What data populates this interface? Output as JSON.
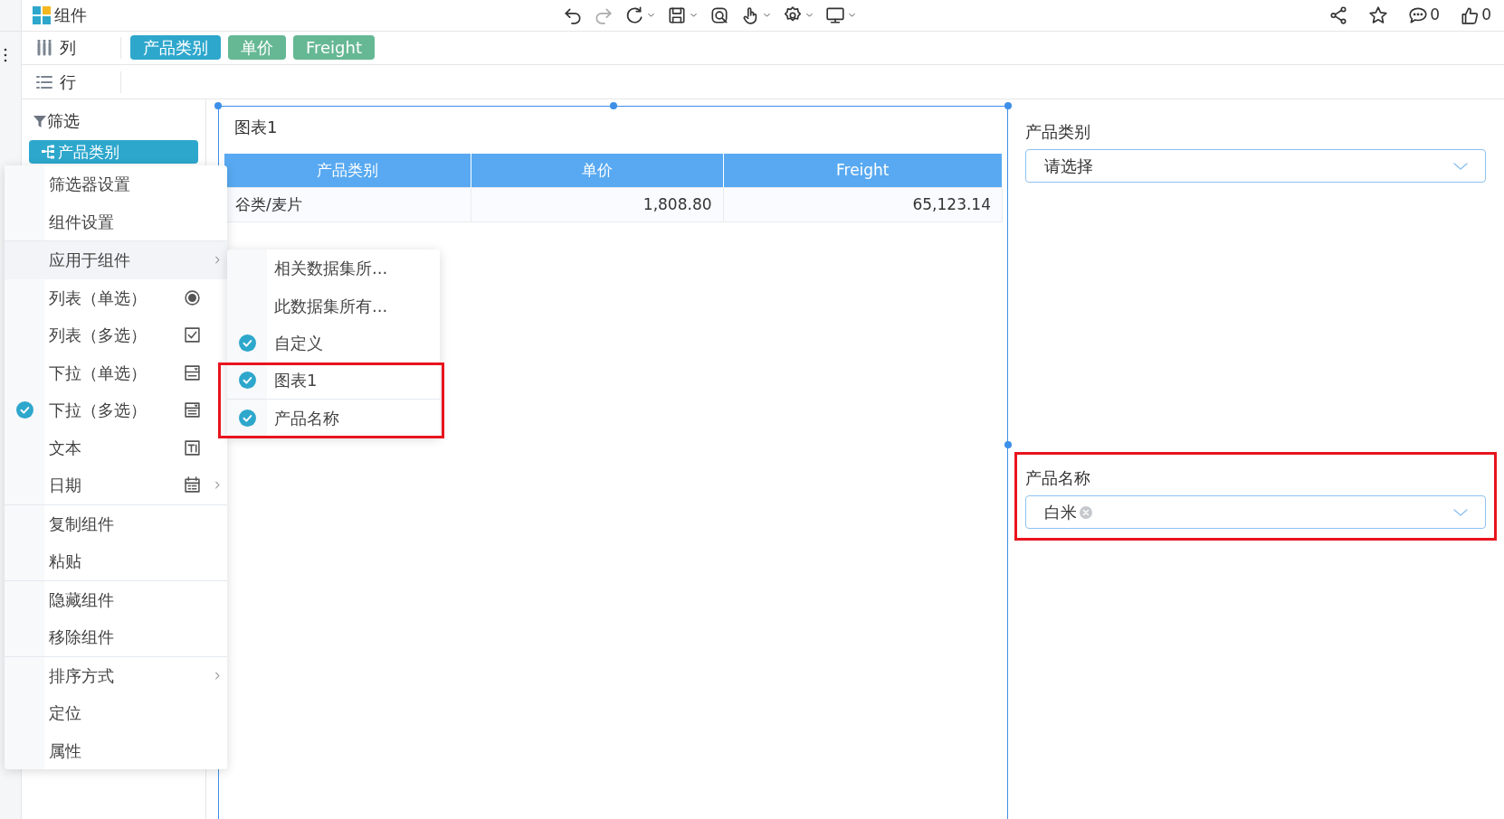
{
  "header": {
    "title": "组件"
  },
  "toolbar": [
    {
      "kind": "undo",
      "disabled": false,
      "dropdown": false
    },
    {
      "kind": "redo",
      "disabled": true,
      "dropdown": false
    },
    {
      "kind": "refresh",
      "disabled": false,
      "dropdown": true
    },
    {
      "kind": "save",
      "disabled": false,
      "dropdown": true
    },
    {
      "kind": "preview",
      "disabled": false,
      "dropdown": false
    },
    {
      "kind": "hand",
      "disabled": false,
      "dropdown": true
    },
    {
      "kind": "settings",
      "disabled": false,
      "dropdown": true
    },
    {
      "kind": "monitor",
      "disabled": false,
      "dropdown": true
    }
  ],
  "actions": [
    {
      "kind": "share"
    },
    {
      "kind": "favorite"
    },
    {
      "kind": "comment",
      "count": "0"
    },
    {
      "kind": "like",
      "count": "0"
    }
  ],
  "columns_shelf": {
    "label": "列",
    "fields": [
      {
        "label": "产品类别",
        "color": "#2ea7cc"
      },
      {
        "label": "单价",
        "color": "#66b894"
      },
      {
        "label": "Freight",
        "color": "#66b894"
      }
    ]
  },
  "rows_shelf": {
    "label": "行"
  },
  "filter_panel": {
    "title": "筛选",
    "items": [
      {
        "label": "产品类别",
        "selected": true
      }
    ]
  },
  "chart": {
    "title": "图表1",
    "columns": [
      "产品类别",
      "单价",
      "Freight"
    ],
    "rows": [
      [
        "谷类/麦片",
        "1,808.80",
        "65,123.14"
      ]
    ]
  },
  "filters": [
    {
      "label": "产品类别",
      "placeholder": "请选择",
      "highlighted": false
    },
    {
      "label": "产品名称",
      "tags": [
        "白米"
      ],
      "highlighted": true
    }
  ],
  "context_menu": {
    "sections": [
      {
        "items": [
          {
            "label": "筛选器设置",
            "kind": "action",
            "checked": false,
            "submenu": false,
            "selected": false
          },
          {
            "label": "组件设置",
            "kind": "action",
            "checked": false,
            "submenu": false,
            "selected": false
          }
        ]
      },
      {
        "items": [
          {
            "label": "应用于组件",
            "kind": "action",
            "checked": false,
            "submenu": true,
            "selected": true
          },
          {
            "label": "列表（单选）",
            "kind": "list-single",
            "checked": false,
            "submenu": false,
            "selected": false
          },
          {
            "label": "列表（多选）",
            "kind": "list-multi",
            "checked": false,
            "submenu": false,
            "selected": false
          },
          {
            "label": "下拉（单选）",
            "kind": "dropdown-single",
            "checked": false,
            "submenu": false,
            "selected": false
          },
          {
            "label": "下拉（多选）",
            "kind": "dropdown-multi",
            "checked": true,
            "submenu": false,
            "selected": false
          },
          {
            "label": "文本",
            "kind": "text",
            "checked": false,
            "submenu": false,
            "selected": false
          },
          {
            "label": "日期",
            "kind": "date",
            "checked": false,
            "submenu": true,
            "selected": false
          }
        ]
      },
      {
        "items": [
          {
            "label": "复制组件",
            "kind": "action",
            "checked": false,
            "submenu": false,
            "selected": false
          },
          {
            "label": "粘贴",
            "kind": "action",
            "checked": false,
            "submenu": false,
            "selected": false
          }
        ]
      },
      {
        "items": [
          {
            "label": "隐藏组件",
            "kind": "action",
            "checked": false,
            "submenu": false,
            "selected": false
          },
          {
            "label": "移除组件",
            "kind": "action",
            "checked": false,
            "submenu": false,
            "selected": false
          }
        ]
      },
      {
        "items": [
          {
            "label": "排序方式",
            "kind": "action",
            "checked": false,
            "submenu": true,
            "selected": false
          },
          {
            "label": "定位",
            "kind": "action",
            "checked": false,
            "submenu": false,
            "selected": false
          },
          {
            "label": "属性",
            "kind": "action",
            "checked": false,
            "submenu": false,
            "selected": false
          }
        ]
      }
    ]
  },
  "submenu": {
    "sections": [
      {
        "highlighted": false,
        "items": [
          {
            "label": "相关数据集所...",
            "checked": false
          },
          {
            "label": "此数据集所有...",
            "checked": false
          },
          {
            "label": "自定义",
            "checked": true
          }
        ]
      },
      {
        "highlighted": true,
        "items": [
          {
            "label": "图表1",
            "checked": true
          },
          {
            "label": "产品名称",
            "checked": true
          }
        ]
      }
    ]
  }
}
